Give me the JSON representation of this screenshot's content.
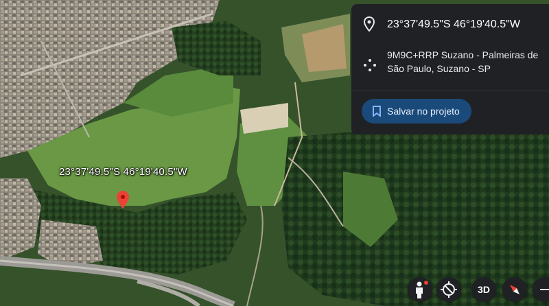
{
  "map": {
    "pin_label": "23°37'49.5\"S 46°19'40.5\"W"
  },
  "info_panel": {
    "coordinates": "23°37'49.5\"S 46°19'40.5\"W",
    "plus_code_address": "9M9C+RRP Suzano - Palmeiras de São Paulo, Suzano - SP",
    "save_button_label": "Salvar no projeto"
  },
  "map_controls": {
    "street_view": "person-icon",
    "rotate": "rotate-reset-icon",
    "three_d_label": "3D",
    "compass": "compass-icon",
    "zoom_out": "minus-icon"
  },
  "colors": {
    "panel_bg": "#202124",
    "save_button_bg": "#1a4a7a",
    "pin_red": "#ea4335"
  }
}
